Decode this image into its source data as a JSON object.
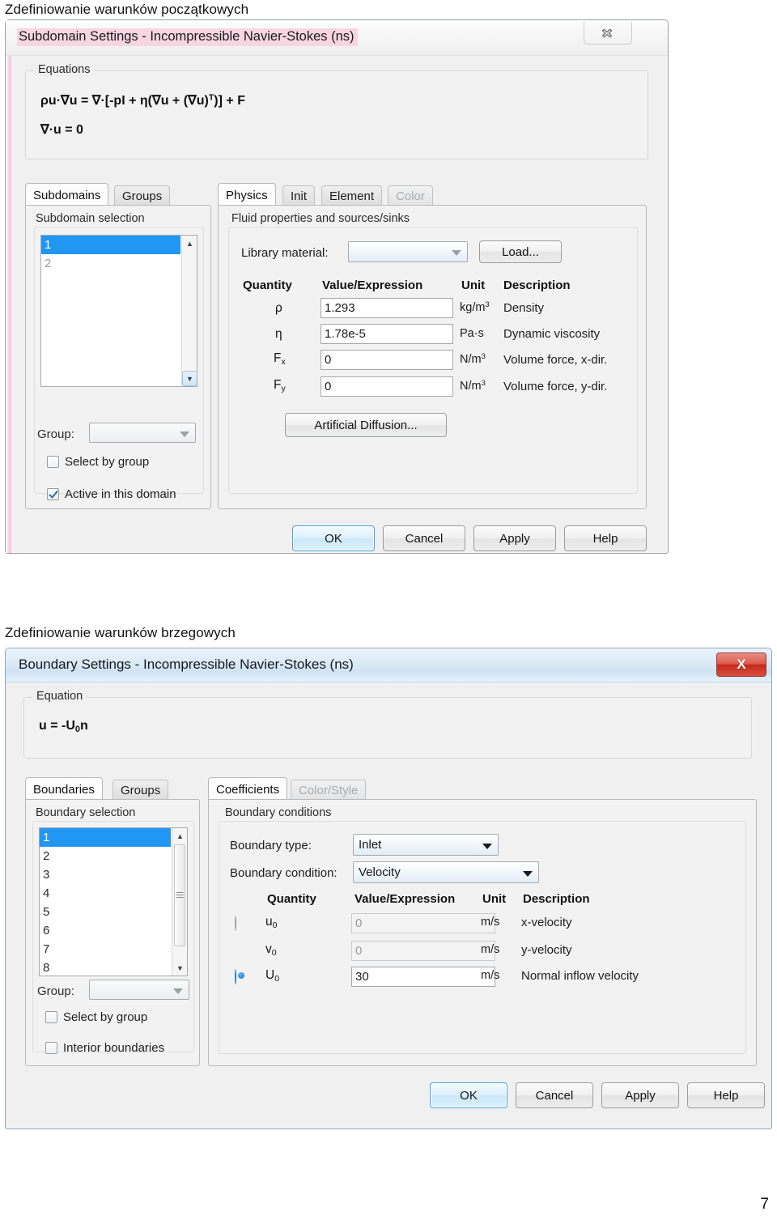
{
  "document": {
    "heading1": "Zdefiniowanie warunków początkowych",
    "heading2": "Zdefiniowanie warunków brzegowych",
    "page_number": "7"
  },
  "colors": {
    "selection_blue": "#2196f3",
    "close_red": "#c62b1b",
    "title_highlight_pink": "#f7d6e2",
    "default_button_blue": "#4aa3de"
  },
  "dialog1": {
    "title": "Subdomain Settings - Incompressible Navier-Stokes (ns)",
    "close_label": "✕",
    "equations": {
      "label": "Equations",
      "line1_html": "ρu·∇u = ∇·[-pI + η(∇u + (∇u)T)] + F",
      "line2_html": "∇·u = 0"
    },
    "left_tabs": [
      {
        "label": "Subdomains",
        "active": true
      },
      {
        "label": "Groups",
        "active": false
      }
    ],
    "selection": {
      "label": "Subdomain selection",
      "items": [
        "1",
        "2"
      ],
      "selected_index": 0,
      "group_label": "Group:",
      "group_value": "",
      "select_by_group": {
        "label": "Select by group",
        "checked": false
      },
      "active_in_domain": {
        "label": "Active in this domain",
        "checked": true
      }
    },
    "right_tabs": [
      {
        "label": "Physics",
        "active": true,
        "disabled": false
      },
      {
        "label": "Init",
        "active": false,
        "disabled": false
      },
      {
        "label": "Element",
        "active": false,
        "disabled": false
      },
      {
        "label": "Color",
        "active": false,
        "disabled": true
      }
    ],
    "fluid": {
      "panel_label": "Fluid properties and sources/sinks",
      "library_material_label": "Library material:",
      "library_material_value": "",
      "load_button": "Load...",
      "columns": [
        "Quantity",
        "Value/Expression",
        "Unit",
        "Description"
      ],
      "rows": [
        {
          "quantity": "ρ",
          "sub": "",
          "value": "1.293",
          "unit": "kg/m",
          "unit_sup": "3",
          "description": "Density"
        },
        {
          "quantity": "η",
          "sub": "",
          "value": "1.78e-5",
          "unit": "Pa·s",
          "unit_sup": "",
          "description": "Dynamic viscosity"
        },
        {
          "quantity": "F",
          "sub": "x",
          "value": "0",
          "unit": "N/m",
          "unit_sup": "3",
          "description": "Volume force, x-dir."
        },
        {
          "quantity": "F",
          "sub": "y",
          "value": "0",
          "unit": "N/m",
          "unit_sup": "3",
          "description": "Volume force, y-dir."
        }
      ],
      "artificial_diffusion_button": "Artificial Diffusion..."
    },
    "buttons": [
      {
        "label": "OK",
        "default": true
      },
      {
        "label": "Cancel",
        "default": false
      },
      {
        "label": "Apply",
        "default": false
      },
      {
        "label": "Help",
        "default": false
      }
    ]
  },
  "dialog2": {
    "title": "Boundary Settings - Incompressible Navier-Stokes (ns)",
    "close_label": "X",
    "equation": {
      "label": "Equation",
      "line1_html": "u = -U0n"
    },
    "left_tabs": [
      {
        "label": "Boundaries",
        "active": true
      },
      {
        "label": "Groups",
        "active": false
      }
    ],
    "selection": {
      "label": "Boundary selection",
      "items": [
        "1",
        "2",
        "3",
        "4",
        "5",
        "6",
        "7",
        "8"
      ],
      "selected_index": 0,
      "group_label": "Group:",
      "group_value": "",
      "select_by_group": {
        "label": "Select by group",
        "checked": false
      },
      "interior_boundaries": {
        "label": "Interior boundaries",
        "checked": false
      }
    },
    "right_tabs": [
      {
        "label": "Coefficients",
        "active": true,
        "disabled": false
      },
      {
        "label": "Color/Style",
        "active": false,
        "disabled": true
      }
    ],
    "conditions": {
      "panel_label": "Boundary conditions",
      "boundary_type_label": "Boundary type:",
      "boundary_type_value": "Inlet",
      "boundary_condition_label": "Boundary condition:",
      "boundary_condition_value": "Velocity",
      "columns": [
        "Quantity",
        "Value/Expression",
        "Unit",
        "Description"
      ],
      "rows": [
        {
          "quantity": "u",
          "sub": "0",
          "value": "0",
          "unit": "m/s",
          "description": "x-velocity",
          "radio": "off",
          "disabled": true
        },
        {
          "quantity": "v",
          "sub": "0",
          "value": "0",
          "unit": "m/s",
          "description": "y-velocity",
          "radio": "none",
          "disabled": true
        },
        {
          "quantity": "U",
          "sub": "0",
          "value": "30",
          "unit": "m/s",
          "description": "Normal inflow velocity",
          "radio": "on",
          "disabled": false
        }
      ]
    },
    "buttons": [
      {
        "label": "OK",
        "default": true
      },
      {
        "label": "Cancel",
        "default": false
      },
      {
        "label": "Apply",
        "default": false
      },
      {
        "label": "Help",
        "default": false
      }
    ]
  }
}
